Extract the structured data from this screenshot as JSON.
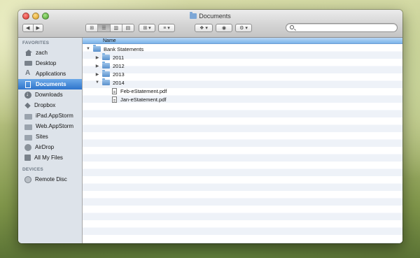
{
  "window": {
    "title": "Documents"
  },
  "toolbar": {
    "back_glyph": "◀",
    "forward_glyph": "▶",
    "arrange_glyph": "⊞ ▾",
    "action_glyph": "⚙ ▾",
    "share_glyph": "≡ ▾",
    "dropbox_glyph": "❖ ▾",
    "quicklook_glyph": "◉"
  },
  "search": {
    "placeholder": ""
  },
  "sidebar": {
    "favorites_header": "FAVORITES",
    "devices_header": "DEVICES",
    "items": [
      {
        "label": "zach",
        "icon": "home-icon"
      },
      {
        "label": "Desktop",
        "icon": "desktop-icon"
      },
      {
        "label": "Applications",
        "icon": "applications-icon"
      },
      {
        "label": "Documents",
        "icon": "documents-icon",
        "selected": true
      },
      {
        "label": "Downloads",
        "icon": "downloads-icon"
      },
      {
        "label": "Dropbox",
        "icon": "dropbox-icon"
      },
      {
        "label": "iPad.AppStorm",
        "icon": "folder-icon"
      },
      {
        "label": "Web.AppStorm",
        "icon": "folder-icon"
      },
      {
        "label": "Sites",
        "icon": "folder-icon"
      },
      {
        "label": "AirDrop",
        "icon": "airdrop-icon"
      },
      {
        "label": "All My Files",
        "icon": "all-files-icon"
      }
    ],
    "devices": [
      {
        "label": "Remote Disc",
        "icon": "disc-icon"
      }
    ]
  },
  "list": {
    "column_name": "Name",
    "rows": [
      {
        "label": "Bank Statements",
        "kind": "folder",
        "expanded": true,
        "level": 0
      },
      {
        "label": "2011",
        "kind": "folder",
        "expanded": false,
        "level": 1
      },
      {
        "label": "2012",
        "kind": "folder",
        "expanded": false,
        "level": 1
      },
      {
        "label": "2013",
        "kind": "folder",
        "expanded": false,
        "level": 1
      },
      {
        "label": "2014",
        "kind": "folder",
        "expanded": true,
        "level": 1
      },
      {
        "label": "Feb-eStatement.pdf",
        "kind": "pdf",
        "level": 2
      },
      {
        "label": "Jan-eStatement.pdf",
        "kind": "pdf",
        "level": 2
      }
    ]
  },
  "colors": {
    "selection": "#2e74cc",
    "header_blue": "#7bb4ea",
    "sidebar_bg": "#dde3ea",
    "folder_blue": "#5a91cc"
  }
}
